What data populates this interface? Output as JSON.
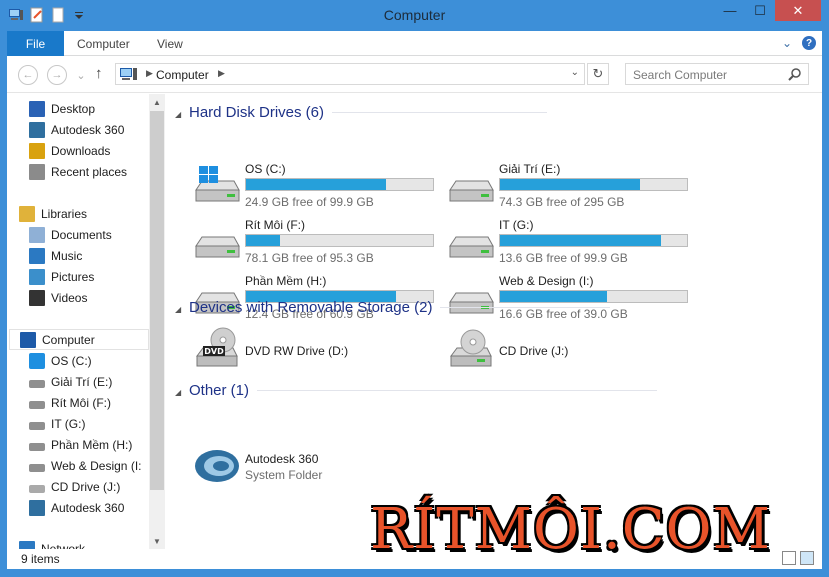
{
  "window": {
    "title": "Computer"
  },
  "ribbon": {
    "file": "File",
    "tabs": [
      "Computer",
      "View"
    ]
  },
  "address": {
    "crumb": "Computer",
    "search_placeholder": "Search Computer"
  },
  "sidebar": {
    "items": [
      {
        "label": "Desktop",
        "icon": "desktop-icon"
      },
      {
        "label": "Autodesk 360",
        "icon": "autodesk-icon"
      },
      {
        "label": "Downloads",
        "icon": "downloads-icon"
      },
      {
        "label": "Recent places",
        "icon": "recent-places-icon"
      },
      {
        "label": "Libraries",
        "icon": "libraries-icon"
      },
      {
        "label": "Documents",
        "icon": "documents-icon"
      },
      {
        "label": "Music",
        "icon": "music-icon"
      },
      {
        "label": "Pictures",
        "icon": "pictures-icon"
      },
      {
        "label": "Videos",
        "icon": "videos-icon"
      },
      {
        "label": "Computer",
        "icon": "computer-icon"
      },
      {
        "label": "OS (C:)",
        "icon": "windows-drive-icon"
      },
      {
        "label": "Giải Trí (E:)",
        "icon": "drive-icon"
      },
      {
        "label": "Rít Môi (F:)",
        "icon": "drive-icon"
      },
      {
        "label": "IT (G:)",
        "icon": "drive-icon"
      },
      {
        "label": "Phần Mềm (H:)",
        "icon": "drive-icon"
      },
      {
        "label": "Web & Design (I:",
        "icon": "drive-icon"
      },
      {
        "label": "CD Drive (J:)",
        "icon": "cd-icon"
      },
      {
        "label": "Autodesk 360",
        "icon": "autodesk-icon"
      },
      {
        "label": "Network",
        "icon": "network-icon"
      }
    ]
  },
  "groups": {
    "hdd": "Hard Disk Drives (6)",
    "removable": "Devices with Removable Storage (2)",
    "other": "Other (1)"
  },
  "drives": [
    {
      "name": "OS (C:)",
      "free": "24.9 GB free of 99.9 GB",
      "used_fraction": 0.75,
      "icon": "windows-drive-icon"
    },
    {
      "name": "Giải Trí (E:)",
      "free": "74.3 GB free of 295 GB",
      "used_fraction": 0.75,
      "icon": "hdd-icon"
    },
    {
      "name": "Rít Môi (F:)",
      "free": "78.1 GB free of 95.3 GB",
      "used_fraction": 0.18,
      "icon": "hdd-icon"
    },
    {
      "name": "IT (G:)",
      "free": "13.6 GB free of 99.9 GB",
      "used_fraction": 0.86,
      "icon": "hdd-icon"
    },
    {
      "name": "Phần Mềm (H:)",
      "free": "12.4 GB free of 60.9 GB",
      "used_fraction": 0.8,
      "icon": "hdd-icon"
    },
    {
      "name": "Web & Design (I:)",
      "free": "16.6 GB free of 39.0 GB",
      "used_fraction": 0.57,
      "icon": "hdd-icon"
    }
  ],
  "devices": [
    {
      "name": "DVD RW Drive (D:)",
      "icon": "dvd-drive-icon",
      "badge": "DVD"
    },
    {
      "name": "CD Drive (J:)",
      "icon": "cd-drive-icon"
    }
  ],
  "other": [
    {
      "name": "Autodesk 360",
      "sub": "System Folder",
      "icon": "autodesk-icon"
    }
  ],
  "status": {
    "items": "9 items"
  },
  "watermark": "RÍTMÔI.COM",
  "colors": {
    "accent": "#1979ca",
    "bar": "#26a0da",
    "group": "#1e3287",
    "frame": "#3d8fd8"
  }
}
